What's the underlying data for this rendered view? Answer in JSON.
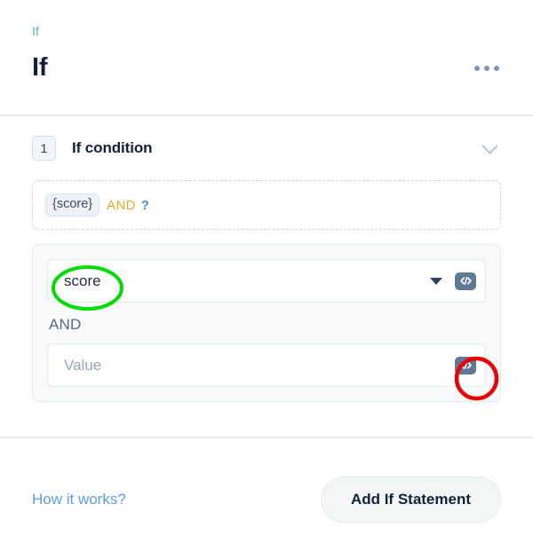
{
  "header": {
    "breadcrumb": "If",
    "title": "If",
    "menu_icon": "kebab-menu-icon"
  },
  "section": {
    "number": "1",
    "title": "If condition",
    "collapse_icon": "chevron-down-icon"
  },
  "preview": {
    "token": "{score}",
    "operator": "AND",
    "unknown": "?"
  },
  "editor": {
    "field_value": "score",
    "dropdown_icon": "chevron-down-icon",
    "code_icon": "code-icon",
    "operator_label": "AND",
    "value_placeholder": "Value",
    "value_code_icon": "code-icon"
  },
  "footer": {
    "how_it_works": "How it works?",
    "add_button": "Add If Statement"
  },
  "annotations": {
    "green_ellipse": {
      "target": "score-field-value",
      "color": "#00dd00"
    },
    "red_circle": {
      "target": "value-code-button",
      "color": "#ee0000"
    }
  },
  "colors": {
    "breadcrumb_blue": "#6a9fe8",
    "title_navy": "#12203c",
    "operator_orange": "#f5a623",
    "question_blue": "#4a90e2",
    "link_blue": "#5b9bf0",
    "code_btn_slate": "#5f7893"
  }
}
